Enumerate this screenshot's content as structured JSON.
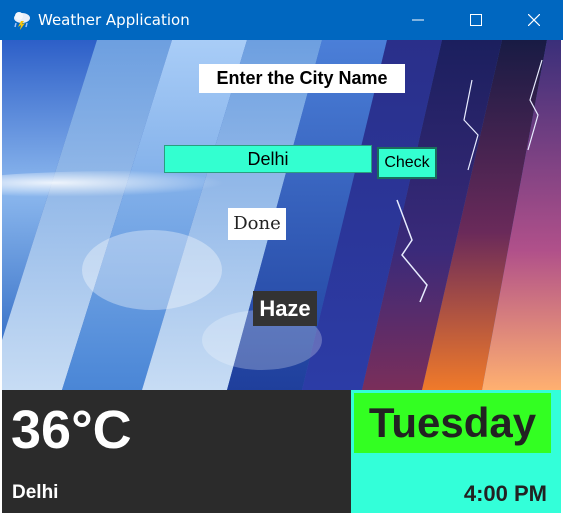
{
  "window": {
    "title": "Weather Application",
    "icon": "cloud-lightning-icon",
    "controls": [
      "minimize-icon",
      "maximize-icon",
      "close-icon"
    ],
    "titlebar_color": "#0067c0"
  },
  "search": {
    "label": "Enter the City Name",
    "input_value": "Delhi",
    "button_label": "Check",
    "accent_color": "#33ffd0"
  },
  "result": {
    "status": "Done",
    "condition": "Haze",
    "temperature": "36°C",
    "city": "Delhi",
    "day": "Tuesday",
    "time": "4:00 PM"
  },
  "colors": {
    "temp_panel": "#2b2b2b",
    "day_panel": "#33ffd9",
    "day_highlight": "#33ff22"
  }
}
